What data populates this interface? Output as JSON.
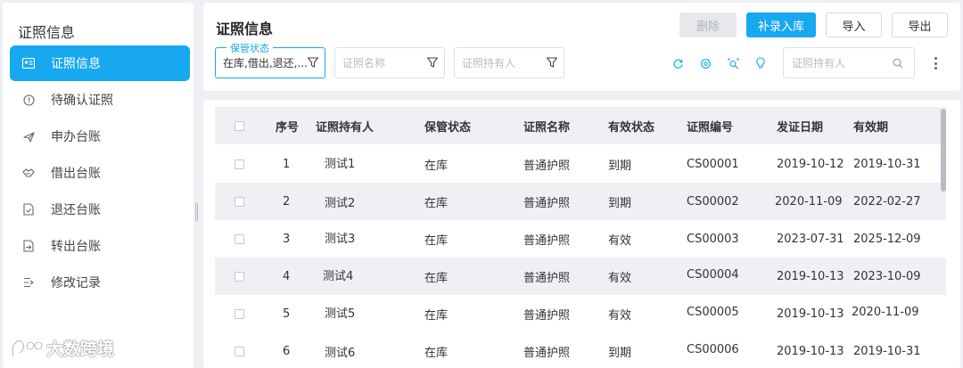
{
  "sidebar": {
    "title": "证照信息",
    "items": [
      {
        "label": "证照信息",
        "icon": "id-card-icon",
        "active": true
      },
      {
        "label": "待确认证照",
        "icon": "alert-circle-icon",
        "active": false
      },
      {
        "label": "申办台账",
        "icon": "plane-icon",
        "active": false
      },
      {
        "label": "借出台账",
        "icon": "handshake-icon",
        "active": false
      },
      {
        "label": "退还台账",
        "icon": "document-return-icon",
        "active": false
      },
      {
        "label": "转出台账",
        "icon": "document-transfer-icon",
        "active": false
      },
      {
        "label": "修改记录",
        "icon": "edit-log-icon",
        "active": false
      }
    ]
  },
  "header": {
    "title": "证照信息",
    "buttons": {
      "delete": "删除",
      "supplement": "补录入库",
      "import": "导入",
      "export": "导出"
    }
  },
  "filters": {
    "status_legend": "保管状态",
    "status_value": "在库,借出,退还,...",
    "name_placeholder": "证照名称",
    "holder_placeholder": "证照持有人",
    "search_placeholder": "证照持有人"
  },
  "toolbar_icons": [
    "refresh-icon",
    "settings-icon",
    "zoom-icon",
    "lightbulb-icon"
  ],
  "table": {
    "columns": [
      "序号",
      "证照持有人",
      "保管状态",
      "证照名称",
      "有效状态",
      "证照编号",
      "发证日期",
      "有效期"
    ],
    "rows": [
      [
        "1",
        "测试1",
        "在库",
        "普通护照",
        "到期",
        "CS00001",
        "2019-10-12",
        "2019-10-31"
      ],
      [
        "2",
        "测试2",
        "在库",
        "普通护照",
        "到期",
        "CS00002",
        "2020-11-09",
        "2022-02-27"
      ],
      [
        "3",
        "测试3",
        "在库",
        "普通护照",
        "有效",
        "CS00003",
        "2023-07-31",
        "2025-12-09"
      ],
      [
        "4",
        "测试4",
        "在库",
        "普通护照",
        "有效",
        "CS00004",
        "2019-10-13",
        "2023-10-09"
      ],
      [
        "5",
        "测试5",
        "在库",
        "普通护照",
        "有效",
        "CS00005",
        "2019-10-13",
        "2020-11-09"
      ],
      [
        "6",
        "测试6",
        "在库",
        "普通护照",
        "到期",
        "CS00006",
        "2019-10-13",
        "2019-10-31"
      ]
    ]
  },
  "watermark": {
    "text": "大数跨境"
  },
  "colors": {
    "accent": "#17a8f0",
    "background": "#eef0f3",
    "row_alt": "#eef0f3"
  }
}
